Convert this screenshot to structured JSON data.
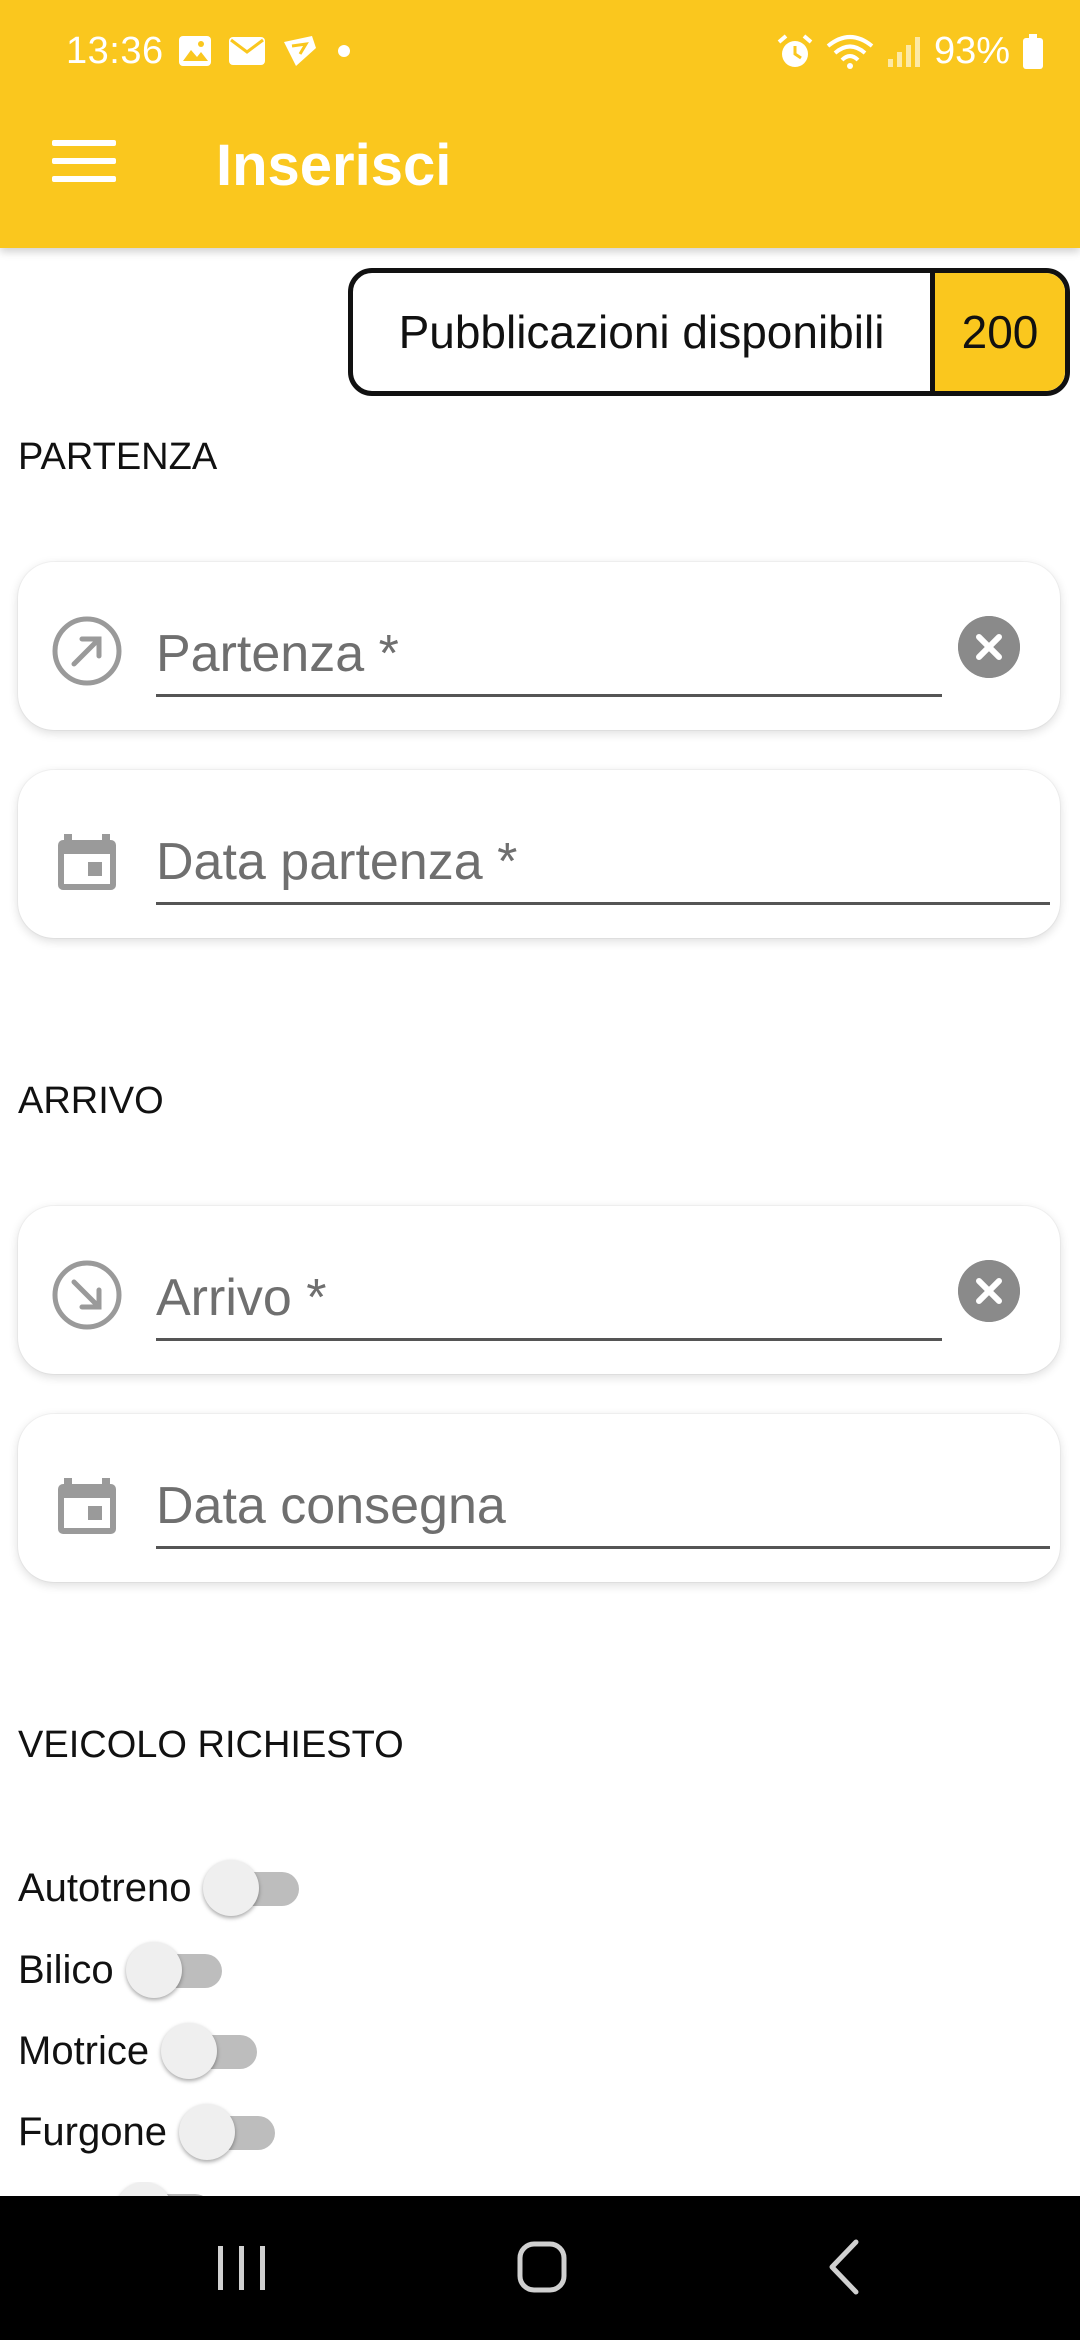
{
  "status_bar": {
    "time": "13:36",
    "battery": "93%"
  },
  "app_bar": {
    "title": "Inserisci",
    "menu_icon": "menu-icon"
  },
  "publications": {
    "label": "Pubblicazioni disponibili",
    "count": "200"
  },
  "partenza": {
    "section_title": "PARTENZA",
    "location_placeholder": "Partenza *",
    "date_placeholder": "Data partenza *"
  },
  "arrivo": {
    "section_title": "ARRIVO",
    "location_placeholder": "Arrivo *",
    "date_placeholder": "Data consegna"
  },
  "veicolo": {
    "section_title": "VEICOLO RICHIESTO",
    "options": [
      {
        "label": "Autotreno",
        "checked": false
      },
      {
        "label": "Bilico",
        "checked": false
      },
      {
        "label": "Motrice",
        "checked": false
      },
      {
        "label": "Furgone",
        "checked": false
      }
    ]
  },
  "colors": {
    "accent": "#FAC71E",
    "text": "#111111",
    "placeholder": "#6F6F6F"
  }
}
